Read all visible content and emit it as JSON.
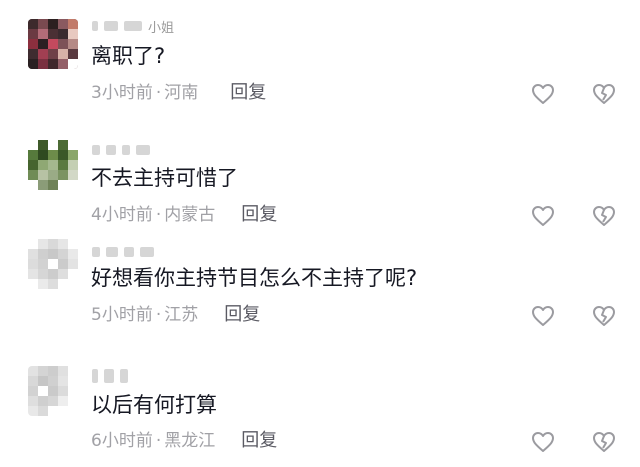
{
  "comments": [
    {
      "username_tail": "小姐",
      "text": "离职了?",
      "time": "3小时前",
      "separator": "·",
      "location": "河南",
      "reply_label": "回复",
      "like_icon": "heart-outline-icon",
      "dislike_icon": "broken-heart-icon"
    },
    {
      "username_tail": "",
      "text": "不去主持可惜了",
      "time": "4小时前",
      "separator": "·",
      "location": "内蒙古",
      "reply_label": "回复",
      "like_icon": "heart-outline-icon",
      "dislike_icon": "broken-heart-icon"
    },
    {
      "username_tail": "",
      "text": "好想看你主持节目怎么不主持了呢?",
      "time": "5小时前",
      "separator": "·",
      "location": "江苏",
      "reply_label": "回复",
      "like_icon": "heart-outline-icon",
      "dislike_icon": "broken-heart-icon"
    },
    {
      "username_tail": "",
      "text": "以后有何打算",
      "time": "6小时前",
      "separator": "·",
      "location": "黑龙江",
      "reply_label": "回复",
      "like_icon": "heart-outline-icon",
      "dislike_icon": "broken-heart-icon"
    }
  ],
  "colors": {
    "text": "#161823",
    "meta": "#a1a1a6",
    "reply": "#5a5a63",
    "icon": "#9b9ba0"
  }
}
